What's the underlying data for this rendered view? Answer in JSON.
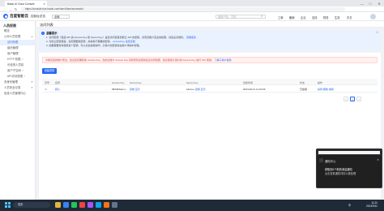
{
  "browser": {
    "tab_title": "Baidu AI Cloud Console",
    "url": "https://console.bce.baidu.com/iam/#/iam/accesslist",
    "win_min": "—",
    "win_max": "□",
    "win_close": "✕",
    "tab_close": "✕"
  },
  "header": {
    "logo_text": "百度智能云",
    "console_link": "控制台总览",
    "region": "全局",
    "search_placeholder": "搜索产品、文档",
    "nav": [
      "工单",
      "备案",
      "企业",
      "支持",
      "财务",
      "生态",
      "中文"
    ]
  },
  "sidebar": {
    "title": "人员权限",
    "items": [
      {
        "label": "概览"
      },
      {
        "label": "公司人员权限"
      },
      {
        "label": "访问列表"
      },
      {
        "label": "组织管理"
      },
      {
        "label": "用户管理"
      },
      {
        "label": "HTTP 权限"
      },
      {
        "label": "可信的人员权"
      },
      {
        "label": "用户子空间"
      },
      {
        "label": "API访问权限"
      },
      {
        "label": "多身份管理"
      },
      {
        "label": "人员安全记录"
      },
      {
        "label": "信息人员管理中心"
      }
    ]
  },
  "page": {
    "title": "访问列表"
  },
  "notice": {
    "title": "温馨提示",
    "line1": "1. 访问密钥（包括 API 的 Access Key 和 Secret Key）是您访问百度智能云 API 的密钥，具有该账户完全的权限，请您妥善保管。",
    "line1_link": "查看更多",
    "line2": "2. 为防止密钥泄露，请定期更换密钥，并禁用不需要的密钥。",
    "line2_link": "AccessKey 最佳实践",
    "line3": "3. 如果需要暂停使用某个密钥，可以点击禁用操作；子用户的密钥请在用户详情中管理。",
    "close": "✕"
  },
  "warning": {
    "text": "为保证您的账户安全，建议您定期轮换 Access Key。您的主账户 Access Key 具有所有资源的完全访问权限，建议使用子用户的 Access Key 进行 API 调用。",
    "link": "了解子用户使用"
  },
  "actions": {
    "create_label": "创建密钥"
  },
  "table": {
    "columns": [
      "序号",
      "名称",
      "Access Key",
      "Secret Key",
      "Secret Key",
      "创建时间",
      "状态",
      "操作"
    ],
    "rows": [
      {
        "index": "1",
        "name": "默认",
        "access_key": "0824b6a2••••",
        "access_link1": "复制",
        "access_link2": "显示",
        "secret_key": "a1ef••••",
        "secret_link1": "复制",
        "secret_link2": "显示",
        "created": "2024-09-11 11:22:09",
        "status": "已启用",
        "ops": [
          "禁用",
          "删除",
          "编辑"
        ]
      }
    ]
  },
  "pagination": {
    "prev": "‹",
    "current": "1",
    "next": "›"
  },
  "toast": {
    "app": "通知中心",
    "title": "获取到1个新的消息通知",
    "body": "点击查看通知详情以便处理",
    "close": "✕"
  },
  "taskbar": {
    "search": "搜索",
    "tray": "中",
    "time": "11:22",
    "date": "2024/9/11"
  }
}
